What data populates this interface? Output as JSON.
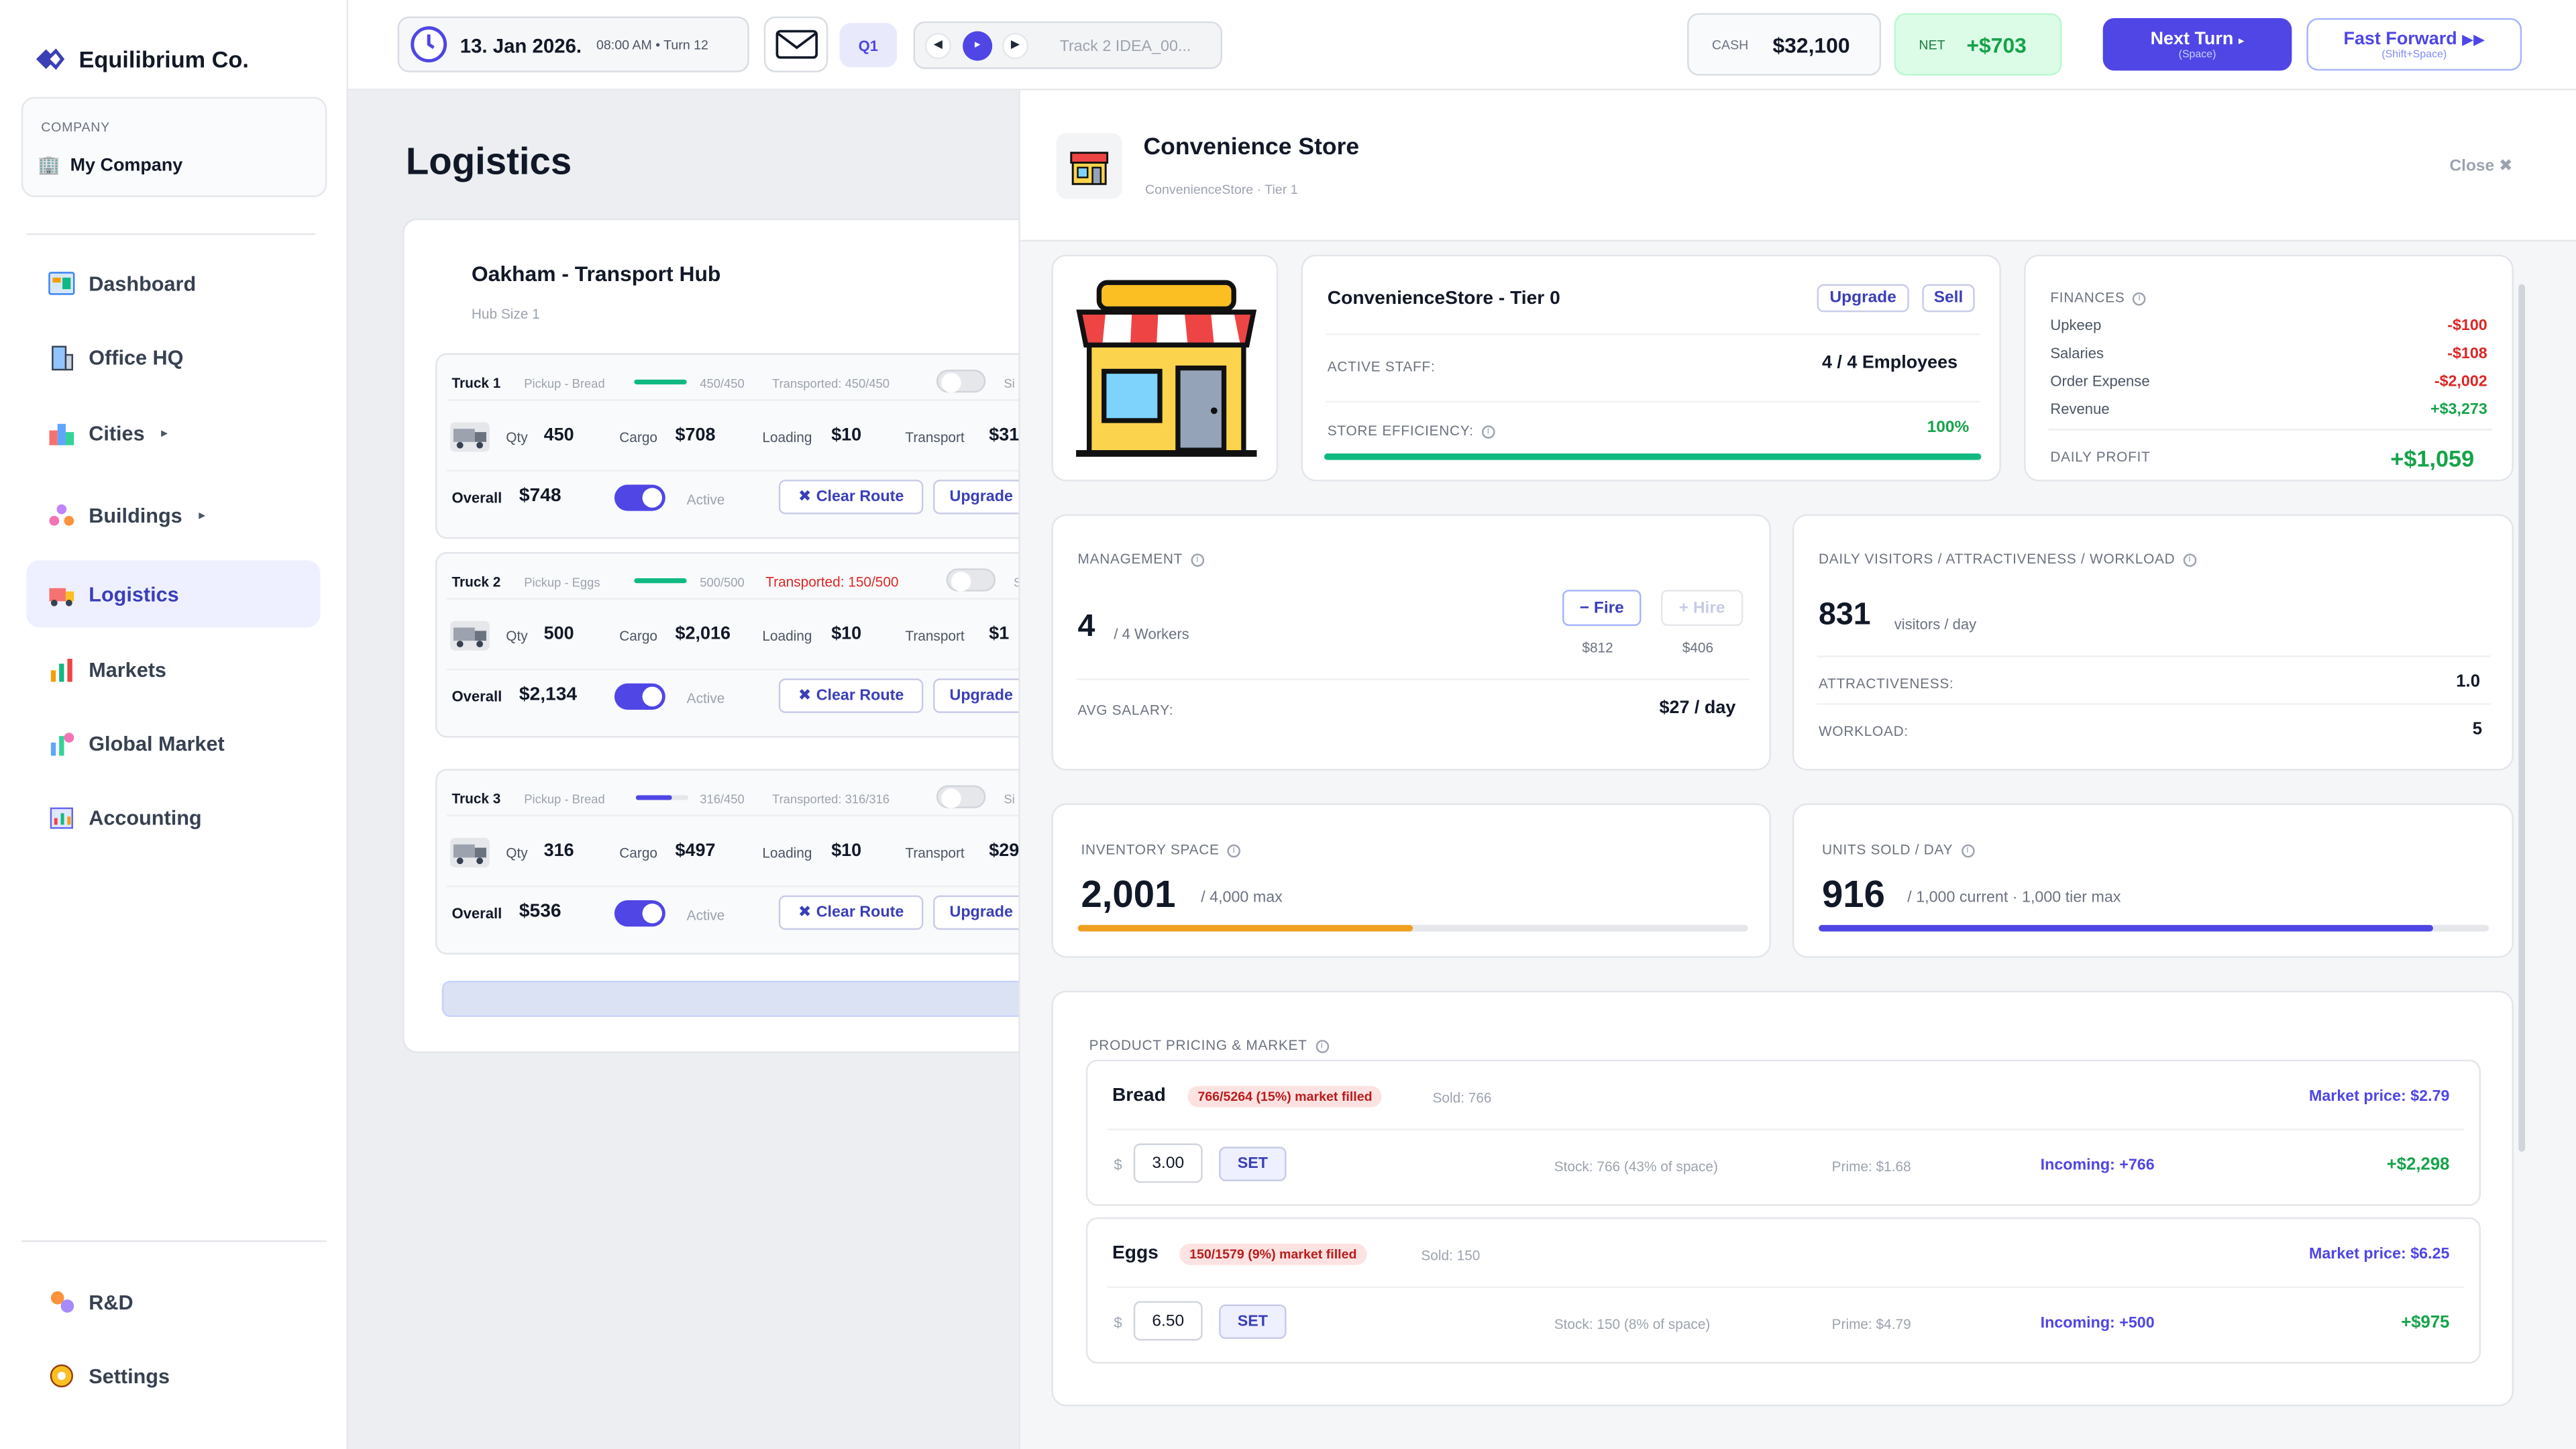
{
  "app": {
    "name": "Equilibrium Co."
  },
  "company": {
    "label": "COMPANY",
    "name": "My Company"
  },
  "nav": {
    "items": [
      {
        "label": "Dashboard"
      },
      {
        "label": "Office HQ"
      },
      {
        "label": "Cities"
      },
      {
        "label": "Buildings"
      },
      {
        "label": "Logistics"
      },
      {
        "label": "Markets"
      },
      {
        "label": "Global Market"
      },
      {
        "label": "Accounting"
      }
    ],
    "bottom": [
      {
        "label": "R&D"
      },
      {
        "label": "Settings"
      }
    ]
  },
  "topbar": {
    "date": "13. Jan 2026.",
    "time": "08:00 AM • Turn 12",
    "quarter": "Q1",
    "track": "Track 2 IDEA_00...",
    "cash_label": "CASH",
    "cash": "$32,100",
    "net_label": "NET",
    "net": "+$703",
    "next_turn": "Next Turn",
    "next_turn_hint": "(Space)",
    "fast_forward": "Fast Forward",
    "fast_forward_hint": "(Shift+Space)"
  },
  "colors": {
    "accent": "#4f46e5",
    "positive": "#16a34a",
    "negative": "#dc2626",
    "warning": "#f0a020"
  },
  "logistics": {
    "title": "Logistics",
    "hub": {
      "name": "Oakham - Transport Hub",
      "size": "Hub Size 1"
    },
    "trucks": [
      {
        "name": "Truck 1",
        "pickup": "Pickup - Bread",
        "load": "450/450",
        "load_fraction": 1.0,
        "transported": "Transported: 450/450",
        "qty_label": "Qty",
        "qty": "450",
        "cargo_label": "Cargo",
        "cargo": "$708",
        "loading_label": "Loading",
        "loading": "$10",
        "transport_label": "Transport",
        "transport": "$31",
        "overall_label": "Overall",
        "overall": "$748",
        "status": "Active",
        "clear": "Clear Route",
        "upgrade": "Upgrade",
        "extra": "Si"
      },
      {
        "name": "Truck 2",
        "pickup": "Pickup - Eggs",
        "load": "500/500",
        "load_fraction": 1.0,
        "transported": "Transported: 150/500",
        "qty_label": "Qty",
        "qty": "500",
        "cargo_label": "Cargo",
        "cargo": "$2,016",
        "loading_label": "Loading",
        "loading": "$10",
        "transport_label": "Transport",
        "transport": "$1",
        "overall_label": "Overall",
        "overall": "$2,134",
        "status": "Active",
        "clear": "Clear Route",
        "upgrade": "Upgrade",
        "extra": "S"
      },
      {
        "name": "Truck 3",
        "pickup": "Pickup - Bread",
        "load": "316/450",
        "load_fraction": 0.7,
        "transported": "Transported: 316/316",
        "qty_label": "Qty",
        "qty": "316",
        "cargo_label": "Cargo",
        "cargo": "$497",
        "loading_label": "Loading",
        "loading": "$10",
        "transport_label": "Transport",
        "transport": "$29",
        "overall_label": "Overall",
        "overall": "$536",
        "status": "Active",
        "clear": "Clear Route",
        "upgrade": "Upgrade",
        "extra": "Si"
      }
    ]
  },
  "panel": {
    "title": "Convenience Store",
    "subtitle": "ConvenienceStore · Tier 1",
    "close": "Close ✖",
    "tier": {
      "name": "ConvenienceStore - Tier 0",
      "upgrade": "Upgrade",
      "sell": "Sell",
      "staff_label": "ACTIVE STAFF:",
      "staff": "4 / 4 Employees",
      "eff_label": "STORE EFFICIENCY:",
      "eff": "100%",
      "eff_fraction": 1.0
    },
    "finances": {
      "label": "FINANCES",
      "rows": [
        {
          "k": "Upkeep",
          "v": "-$100"
        },
        {
          "k": "Salaries",
          "v": "-$108"
        },
        {
          "k": "Order Expense",
          "v": "-$2,002"
        },
        {
          "k": "Revenue",
          "v": "+$3,273"
        }
      ],
      "profit_label": "DAILY PROFIT",
      "profit": "+$1,059"
    },
    "management": {
      "label": "MANAGEMENT",
      "workers": "4",
      "workers_sub": "/ 4 Workers",
      "fire": "− Fire",
      "hire": "+ Hire",
      "fire_cost": "$812",
      "hire_cost": "$406",
      "salary_label": "AVG SALARY:",
      "salary": "$27 / day"
    },
    "visitors": {
      "label": "DAILY VISITORS / ATTRACTIVENESS / WORKLOAD",
      "count": "831",
      "unit": "visitors / day",
      "attr_label": "ATTRACTIVENESS:",
      "attr": "1.0",
      "work_label": "WORKLOAD:",
      "work": "5"
    },
    "inventory": {
      "label": "INVENTORY SPACE",
      "value": "2,001",
      "max": "/ 4,000 max",
      "fraction": 0.5
    },
    "units": {
      "label": "UNITS SOLD / DAY",
      "value": "916",
      "max": "/ 1,000 current",
      "tier_max": "1,000 tier max",
      "fraction": 0.916
    },
    "pricing": {
      "label": "PRODUCT PRICING & MARKET",
      "products": [
        {
          "name": "Bread",
          "filled": "766/5264 (15%) market filled",
          "sold": "Sold: 766",
          "market": "Market price: $2.79",
          "currency": "$",
          "price": "3.00",
          "set": "SET",
          "stock": "Stock: 766 (43% of space)",
          "prime": "Prime: $1.68",
          "incoming": "Incoming: +766",
          "profit": "+$2,298"
        },
        {
          "name": "Eggs",
          "filled": "150/1579 (9%) market filled",
          "sold": "Sold: 150",
          "market": "Market price: $6.25",
          "currency": "$",
          "price": "6.50",
          "set": "SET",
          "stock": "Stock: 150 (8% of space)",
          "prime": "Prime: $4.79",
          "incoming": "Incoming: +500",
          "profit": "+$975"
        }
      ]
    }
  }
}
